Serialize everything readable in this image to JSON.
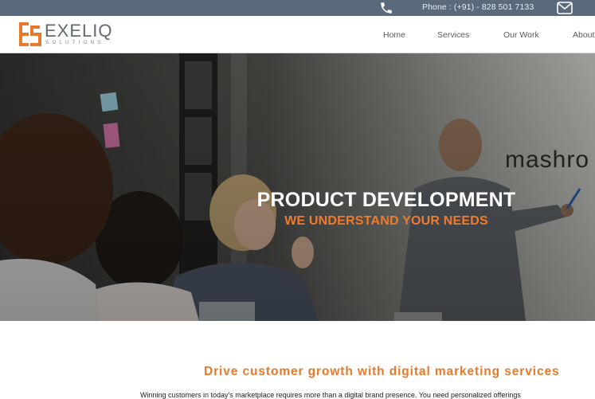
{
  "topbar": {
    "phone_text": "Phone : (+91) - 828 501 7133",
    "phone_icon": "phone-icon",
    "mail_icon": "mail-icon",
    "background": "#5b6a7a"
  },
  "logo": {
    "word": "EXELIQ",
    "sub": "SOLUTIONS",
    "accent": "#e8782a"
  },
  "nav": {
    "items": [
      "Home",
      "Services",
      "Our Work",
      "About"
    ]
  },
  "hero": {
    "title": "PRODUCT DEVELOPMENT",
    "subtitle": "WE UNDERSTAND YOUR NEEDS",
    "wall_text": "mashro"
  },
  "section": {
    "title": "Drive customer growth with digital marketing services",
    "body": "Winning customers in today's marketplace requires more than a digital brand presence. You need personalized offerings"
  }
}
